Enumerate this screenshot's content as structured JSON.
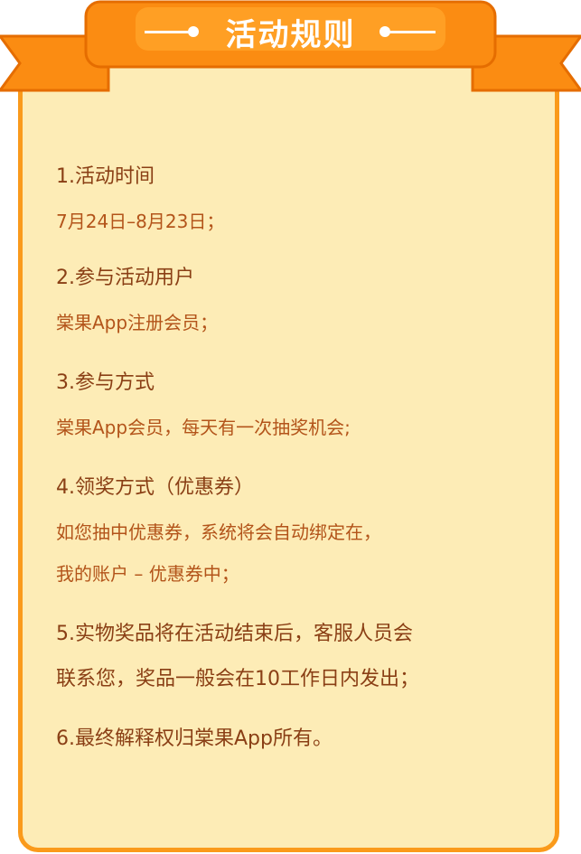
{
  "banner": {
    "title": "活动规则"
  },
  "rules": [
    {
      "title": "1.活动时间",
      "lines": [
        "7月24日–8月23日；"
      ]
    },
    {
      "title": "2.参与活动用户",
      "lines": [
        "棠果App注册会员；"
      ]
    },
    {
      "title": "3.参与方式",
      "lines": [
        "棠果App会员，每天有一次抽奖机会;"
      ]
    },
    {
      "title": "4.领奖方式（优惠券）",
      "lines": [
        "如您抽中优惠券，系统将会自动绑定在，",
        "我的账户 – 优惠券中；"
      ]
    },
    {
      "title": "5.实物奖品将在活动结束后，客服人员会",
      "lines": [
        "联系您，奖品一般会在10工作日内发出；"
      ]
    },
    {
      "title": "6.最终解释权归棠果App所有。",
      "lines": []
    }
  ],
  "colors": {
    "card_bg": "#fdecb6",
    "border": "#fa9a1b",
    "ribbon": "#fb8c12",
    "text": "#8a3f15"
  }
}
